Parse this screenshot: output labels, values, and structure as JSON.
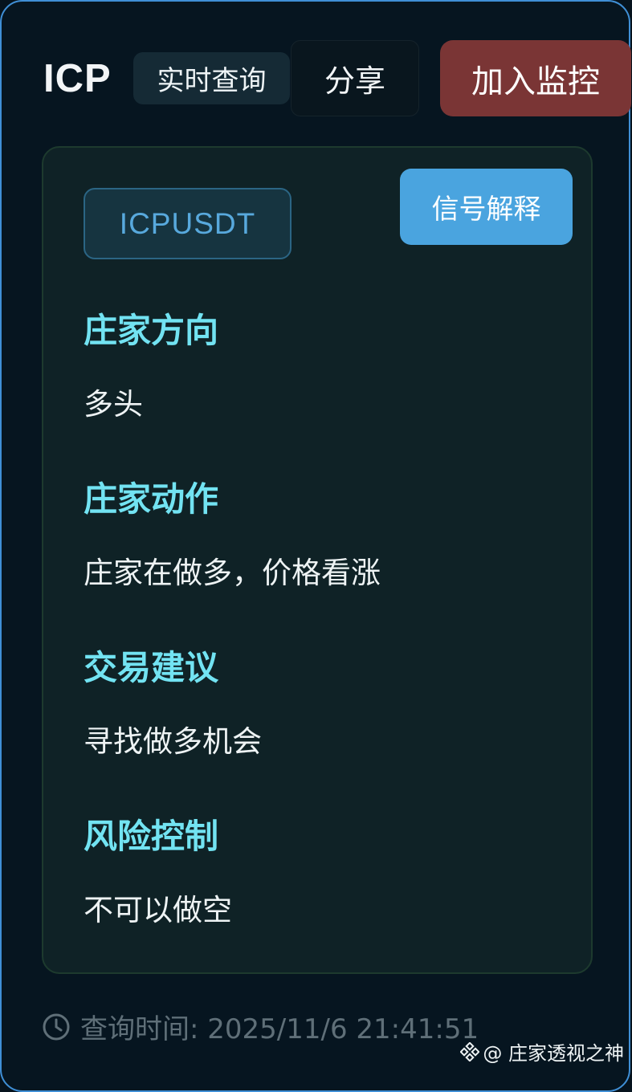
{
  "header": {
    "symbol": "ICP",
    "realtime_label": "实时查询",
    "share_label": "分享",
    "monitor_label": "加入监控"
  },
  "card": {
    "pair": "ICPUSDT",
    "explain_label": "信号解释",
    "sections": [
      {
        "title": "庄家方向",
        "value": "多头"
      },
      {
        "title": "庄家动作",
        "value": "庄家在做多，价格看涨"
      },
      {
        "title": "交易建议",
        "value": "寻找做多机会"
      },
      {
        "title": "风险控制",
        "value": "不可以做空"
      }
    ]
  },
  "footer": {
    "query_time": "查询时间: 2025/11/6 21:41:51",
    "icon": "clock-icon"
  },
  "watermark": {
    "text": "@ 庄家透视之神",
    "icon": "binance-logo-icon"
  },
  "colors": {
    "background": "#061520",
    "accent_title": "#72e3f2",
    "monitor_button": "#7a3535",
    "explain_button": "#4aa4df",
    "frame_border": "#3f8fd6"
  }
}
